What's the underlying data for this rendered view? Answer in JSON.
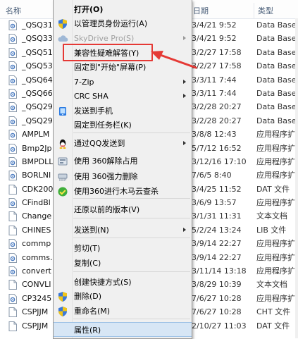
{
  "columns": {
    "name": "名称",
    "date": "日期",
    "type": "类型"
  },
  "files": [
    {
      "name": "_QSQ31",
      "date": "3/4/21 9:52",
      "type": "Data Base",
      "icon": "dll-icon"
    },
    {
      "name": "_QSQ33",
      "date": "3/4/21 9:52",
      "type": "Data Base",
      "icon": "dll-icon"
    },
    {
      "name": "_QSQ51",
      "date": "3/2/27 17:58",
      "type": "Data Base",
      "icon": "dll-icon"
    },
    {
      "name": "_QSQ53",
      "date": "3/2/27 17:58",
      "type": "Data Base",
      "icon": "dll-icon"
    },
    {
      "name": "_QSQ64",
      "date": "3/3/11 7:44",
      "type": "Data Base",
      "icon": "dll-icon"
    },
    {
      "name": "_QSQ66",
      "date": "3/3/11 7:44",
      "type": "Data Base",
      "icon": "dll-icon"
    },
    {
      "name": "_QSQ29",
      "date": "3/2/28 20:27",
      "type": "Data Base",
      "icon": "dll-icon"
    },
    {
      "name": "_QSQ29",
      "date": "3/2/28 20:27",
      "type": "Data Base",
      "icon": "dll-icon"
    },
    {
      "name": "AMPLM",
      "date": "3/8/8 12:43",
      "type": "应用程序扩",
      "icon": "dll-icon"
    },
    {
      "name": "Bmp2Jp",
      "date": "5/7/12 16:52",
      "type": "应用程序扩",
      "icon": "dll-icon"
    },
    {
      "name": "BMPDLL",
      "date": "3/12/16 17:10",
      "type": "应用程序扩",
      "icon": "dll-icon"
    },
    {
      "name": "BORLNI",
      "date": "7/6/5 8:40",
      "type": "应用程序扩",
      "icon": "dll-icon"
    },
    {
      "name": "CDK200",
      "date": "3/4/25 11:52",
      "type": "DAT 文件",
      "icon": "file-icon"
    },
    {
      "name": "CFindBl",
      "date": "3/6/9 13:57",
      "type": "应用程序扩",
      "icon": "dll-icon"
    },
    {
      "name": "Change",
      "date": "3/1/31 11:31",
      "type": "文本文档",
      "icon": "file-icon"
    },
    {
      "name": "CHINES",
      "date": "5/2/24 13:24",
      "type": "LIB 文件",
      "icon": "file-icon"
    },
    {
      "name": "commp",
      "date": "3/9/14 22:27",
      "type": "应用程序扩",
      "icon": "dll-icon"
    },
    {
      "name": "comms.",
      "date": "3/9/14 22:27",
      "type": "应用程序扩",
      "icon": "dll-icon"
    },
    {
      "name": "convert",
      "date": "3/11/14 13:18",
      "type": "应用程序扩",
      "icon": "dll-icon"
    },
    {
      "name": "CONVLI",
      "date": "3/8/29 10:39",
      "type": "文本文档",
      "icon": "file-icon"
    },
    {
      "name": "CP3245",
      "date": "7/6/27 10:28",
      "type": "应用程序扩",
      "icon": "dll-icon"
    },
    {
      "name": "CSPJJM",
      "date": "7/6/27 10:28",
      "type": "CHT 文件",
      "icon": "file-icon"
    },
    {
      "name": "CSPJJM",
      "date": "2/10/27 11:03",
      "type": "DAT 文件",
      "icon": "file-icon"
    }
  ],
  "menu": {
    "items": [
      {
        "label": "打开(O)",
        "bold": true
      },
      {
        "label": "以管理员身份运行(A)",
        "icon": "uac-shield-icon"
      },
      {
        "label": "SkyDrive Pro(S)",
        "icon": "skydrive-icon",
        "disabled": true,
        "submenu": true
      },
      {
        "label": "兼容性疑难解答(Y)"
      },
      {
        "label": "固定到\"开始\"屏幕(P)"
      },
      {
        "label": "7-Zip",
        "submenu": true
      },
      {
        "label": "CRC SHA",
        "submenu": true
      },
      {
        "label": "发送到手机",
        "icon": "phone-icon"
      },
      {
        "label": "固定到任务栏(K)"
      },
      {
        "label": "通过QQ发送到",
        "icon": "qq-icon",
        "submenu": true
      },
      {
        "label": "使用 360解除占用",
        "icon": "unlock-360-icon"
      },
      {
        "label": "使用 360强力删除",
        "icon": "shred-360-icon"
      },
      {
        "label": "使用360进行木马云查杀",
        "icon": "trojan-scan-360-icon"
      },
      {
        "label": "还原以前的版本(V)"
      },
      {
        "label": "发送到(N)",
        "submenu": true
      },
      {
        "label": "剪切(T)"
      },
      {
        "label": "复制(C)"
      },
      {
        "label": "创建快捷方式(S)"
      },
      {
        "label": "删除(D)",
        "icon": "uac-shield-icon"
      },
      {
        "label": "重命名(M)",
        "icon": "uac-shield-icon"
      },
      {
        "label": "属性(R)",
        "hover": true
      }
    ]
  },
  "annotation": {
    "color": "#e53935",
    "highlighted_item": "兼容性疑难解答(Y)"
  }
}
